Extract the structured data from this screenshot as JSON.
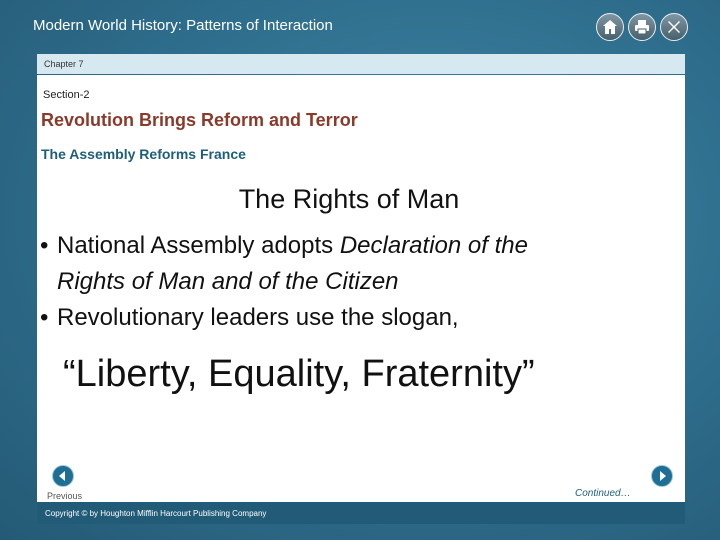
{
  "app": {
    "title": "Modern World History: Patterns of Interaction"
  },
  "toolbar": {
    "home_icon": "home-icon",
    "print_icon": "print-icon",
    "close_icon": "close-icon"
  },
  "chapter": "Chapter 7",
  "section": {
    "label": "Section-2",
    "title": "Revolution Brings Reform and Terror",
    "subtitle": "The Assembly Reforms France"
  },
  "slide": {
    "heading": "The Rights of Man",
    "bullets": [
      {
        "prefix": "National Assembly adopts ",
        "italic": "Declaration of the Rights of Man and of the Citizen",
        "italic_line1": "Declaration of the",
        "italic_line2": "Rights of Man and of the Citizen"
      },
      {
        "text": "Revolutionary leaders use the slogan,"
      }
    ],
    "slogan": "“Liberty,  Equality, Fraternity”"
  },
  "nav": {
    "previous_label": "Previous",
    "next_label": "Next",
    "continued": "Continued…"
  },
  "footer": {
    "copyright": "Copyright © by Houghton Mifflin Harcourt Publishing Company"
  },
  "colors": {
    "background": "#2f6f8e",
    "section_title": "#8b3a2a",
    "subsection": "#1f5e79",
    "chapter_bar": "#d6e9f1",
    "footer_bar": "#215b78"
  }
}
